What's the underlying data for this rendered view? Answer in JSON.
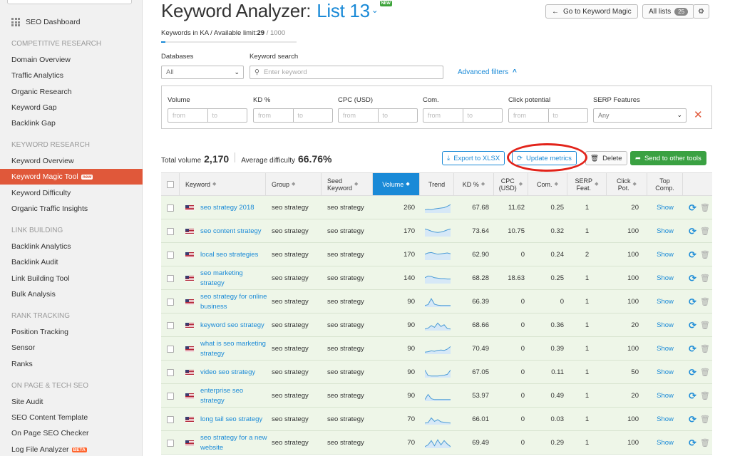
{
  "sidebar": {
    "dashboard": "SEO Dashboard",
    "sections": [
      {
        "heading": "COMPETITIVE RESEARCH",
        "items": [
          "Domain Overview",
          "Traffic Analytics",
          "Organic Research",
          "Keyword Gap",
          "Backlink Gap"
        ]
      },
      {
        "heading": "KEYWORD RESEARCH",
        "items": [
          "Keyword Overview",
          "Keyword Magic Tool",
          "Keyword Difficulty",
          "Organic Traffic Insights"
        ]
      },
      {
        "heading": "LINK BUILDING",
        "items": [
          "Backlink Analytics",
          "Backlink Audit",
          "Link Building Tool",
          "Bulk Analysis"
        ]
      },
      {
        "heading": "RANK TRACKING",
        "items": [
          "Position Tracking",
          "Sensor",
          "Ranks"
        ]
      },
      {
        "heading": "ON PAGE & TECH SEO",
        "items": [
          "Site Audit",
          "SEO Content Template",
          "On Page SEO Checker",
          "Log File Analyzer"
        ]
      }
    ],
    "active_item": "Keyword Magic Tool",
    "badge_new": "new",
    "badge_beta": "BETA",
    "accent_color": "#e0583a"
  },
  "header": {
    "title": "Keyword Analyzer:",
    "list_name": "List 13",
    "new_badge": "NEW",
    "goto_button": "Go to Keyword Magic",
    "all_lists_button": "All lists",
    "all_lists_count": "25",
    "settings_icon": "gear-icon"
  },
  "limits": {
    "label": "Keywords in KA / Available limit:",
    "used": "29",
    "separator": "/",
    "max": "1000",
    "progress": 0.029
  },
  "search": {
    "databases_label": "Databases",
    "databases_value": "All",
    "keyword_label": "Keyword search",
    "keyword_placeholder": "Enter keyword",
    "advanced_filters": "Advanced filters"
  },
  "filters": {
    "fields": [
      {
        "label": "Volume",
        "from": "from",
        "to": "to"
      },
      {
        "label": "KD %",
        "from": "from",
        "to": "to"
      },
      {
        "label": "CPC (USD)",
        "from": "from",
        "to": "to"
      },
      {
        "label": "Com.",
        "from": "from",
        "to": "to"
      },
      {
        "label": "Click potential",
        "from": "from",
        "to": "to"
      }
    ],
    "serp_label": "SERP Features",
    "serp_value": "Any"
  },
  "summary": {
    "total_volume_label": "Total volume",
    "total_volume": "2,170",
    "avg_difficulty_label": "Average difficulty",
    "avg_difficulty": "66.76%"
  },
  "actions": {
    "export": "Export to XLSX",
    "update": "Update metrics",
    "delete": "Delete",
    "send": "Send to other tools"
  },
  "table": {
    "headers": {
      "keyword": "Keyword",
      "group": "Group",
      "seed_1": "Seed",
      "seed_2": "Keyword",
      "volume": "Volume",
      "trend": "Trend",
      "kd": "KD %",
      "cpc_1": "CPC",
      "cpc_2": "(USD)",
      "com": "Com.",
      "serp_1": "SERP",
      "serp_2": "Feat.",
      "click_1": "Click",
      "click_2": "Pot.",
      "top_1": "Top",
      "top_2": "Comp."
    },
    "rows": [
      {
        "keyword": "seo strategy 2018",
        "group": "seo strategy",
        "seed": "seo strategy",
        "volume": "260",
        "kd": "67.68",
        "cpc": "11.62",
        "com": "0.25",
        "serp": "1",
        "click": "20",
        "top": "Show",
        "trend": [
          0.3,
          0.35,
          0.3,
          0.4,
          0.45,
          0.5,
          0.55,
          0.7,
          0.9
        ]
      },
      {
        "keyword": "seo content strategy",
        "group": "seo strategy",
        "seed": "seo strategy",
        "volume": "170",
        "kd": "73.64",
        "cpc": "10.75",
        "com": "0.32",
        "serp": "1",
        "click": "100",
        "top": "Show",
        "trend": [
          0.8,
          0.7,
          0.55,
          0.45,
          0.4,
          0.45,
          0.55,
          0.7,
          0.8
        ]
      },
      {
        "keyword": "local seo strategies",
        "group": "seo strategy",
        "seed": "seo strategy",
        "volume": "170",
        "kd": "62.90",
        "cpc": "0",
        "com": "0.24",
        "serp": "2",
        "click": "100",
        "top": "Show",
        "trend": [
          0.6,
          0.75,
          0.8,
          0.7,
          0.6,
          0.65,
          0.7,
          0.75,
          0.65
        ]
      },
      {
        "keyword": "seo marketing strategy",
        "group": "seo strategy",
        "seed": "seo strategy",
        "volume": "140",
        "kd": "68.28",
        "cpc": "18.63",
        "com": "0.25",
        "serp": "1",
        "click": "100",
        "top": "Show",
        "trend": [
          0.6,
          0.8,
          0.75,
          0.6,
          0.55,
          0.5,
          0.5,
          0.45,
          0.45
        ]
      },
      {
        "keyword": "seo strategy for online business",
        "group": "seo strategy",
        "seed": "seo strategy",
        "volume": "90",
        "kd": "66.39",
        "cpc": "0",
        "com": "0",
        "serp": "1",
        "click": "100",
        "top": "Show",
        "trend": [
          0.1,
          0.2,
          0.9,
          0.25,
          0.15,
          0.1,
          0.1,
          0.1,
          0.1
        ]
      },
      {
        "keyword": "keyword seo strategy",
        "group": "seo strategy",
        "seed": "seo strategy",
        "volume": "90",
        "kd": "68.66",
        "cpc": "0",
        "com": "0.36",
        "serp": "1",
        "click": "20",
        "top": "Show",
        "trend": [
          0.1,
          0.2,
          0.5,
          0.3,
          0.8,
          0.4,
          0.6,
          0.15,
          0.1
        ]
      },
      {
        "keyword": "what is seo marketing strategy",
        "group": "seo strategy",
        "seed": "seo strategy",
        "volume": "90",
        "kd": "70.49",
        "cpc": "0",
        "com": "0.39",
        "serp": "1",
        "click": "100",
        "top": "Show",
        "trend": [
          0.15,
          0.2,
          0.3,
          0.25,
          0.35,
          0.4,
          0.35,
          0.5,
          0.8
        ]
      },
      {
        "keyword": "video seo strategy",
        "group": "seo strategy",
        "seed": "seo strategy",
        "volume": "90",
        "kd": "67.05",
        "cpc": "0",
        "com": "0.11",
        "serp": "1",
        "click": "50",
        "top": "Show",
        "trend": [
          0.8,
          0.15,
          0.1,
          0.1,
          0.1,
          0.15,
          0.2,
          0.3,
          0.8
        ]
      },
      {
        "keyword": "enterprise seo strategy",
        "group": "seo strategy",
        "seed": "seo strategy",
        "volume": "90",
        "kd": "53.97",
        "cpc": "0",
        "com": "0.49",
        "serp": "1",
        "click": "20",
        "top": "Show",
        "trend": [
          0.1,
          0.7,
          0.2,
          0.1,
          0.1,
          0.1,
          0.1,
          0.1,
          0.1
        ]
      },
      {
        "keyword": "long tail seo strategy",
        "group": "seo strategy",
        "seed": "seo strategy",
        "volume": "70",
        "kd": "66.01",
        "cpc": "0",
        "com": "0.03",
        "serp": "1",
        "click": "100",
        "top": "Show",
        "trend": [
          0.1,
          0.15,
          0.7,
          0.3,
          0.5,
          0.25,
          0.2,
          0.15,
          0.1
        ]
      },
      {
        "keyword": "seo strategy for a new website",
        "group": "seo strategy",
        "seed": "seo strategy",
        "volume": "70",
        "kd": "69.49",
        "cpc": "0",
        "com": "0.29",
        "serp": "1",
        "click": "100",
        "top": "Show",
        "trend": [
          0.1,
          0.3,
          0.8,
          0.2,
          0.9,
          0.3,
          0.8,
          0.4,
          0.1
        ]
      }
    ]
  }
}
